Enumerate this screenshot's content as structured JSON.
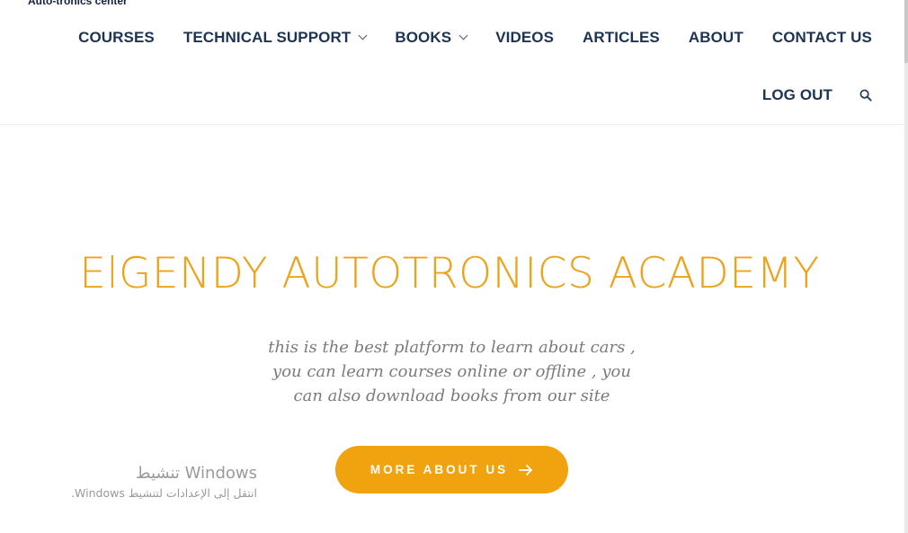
{
  "header": {
    "brand": "Auto-tronics center",
    "nav": [
      {
        "label": "COURSES",
        "has_dropdown": false
      },
      {
        "label": "TECHNICAL SUPPORT",
        "has_dropdown": true
      },
      {
        "label": "BOOKS",
        "has_dropdown": true
      },
      {
        "label": "VIDEOS",
        "has_dropdown": false
      },
      {
        "label": "ARTICLES",
        "has_dropdown": false
      },
      {
        "label": "ABOUT",
        "has_dropdown": false
      },
      {
        "label": "CONTACT US",
        "has_dropdown": false
      }
    ],
    "logout_label": "LOG OUT",
    "search_icon": "search-icon"
  },
  "hero": {
    "title": "ElGENDY AUTOTRONICS ACADEMY",
    "description": "this is the best platform to learn about cars , you can learn courses online or offline , you can also download books from our site",
    "cta_label": "MORE ABOUT US",
    "cta_icon": "arrow-right-icon"
  },
  "watermark": {
    "title": "تنشيط Windows",
    "subtitle": "انتقل إلى الإعدادات لتنشيط Windows."
  },
  "colors": {
    "nav_text": "#1d3353",
    "accent": "#eca31c",
    "button": "#f0a30e",
    "body_text": "#7b7b7b"
  }
}
